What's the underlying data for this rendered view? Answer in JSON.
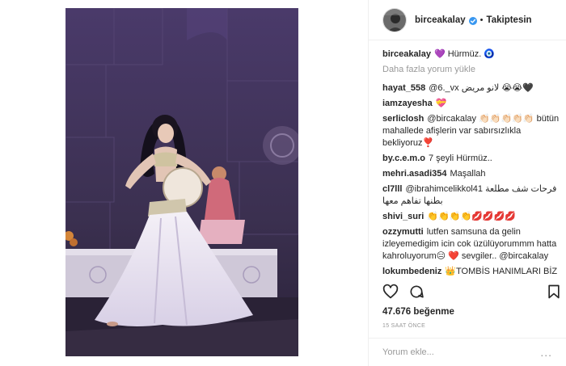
{
  "post": {
    "photo_icon": "dancer-photo",
    "photo_alt": "belly dancer photo"
  },
  "header": {
    "username": "birceakalay",
    "separator": "•",
    "follow_label": "Takiptesin",
    "avatar_icon": "avatar"
  },
  "caption": {
    "username": "birceakalay",
    "text": "💜 Hürmüz. 🧿"
  },
  "load_more": "Daha fazla yorum yükle",
  "comments": [
    {
      "user": "hayat_558",
      "text": "@6._vx لانو مريض 😭😭🖤"
    },
    {
      "user": "iamzayesha",
      "text": "💝"
    },
    {
      "user": "serliclosh",
      "text": "@bircakalay 👏🏻👏🏻👏🏻👏🏻👏🏻 bütün mahallede afişlerin var sabırsızlıkla bekliyoruz❣️"
    },
    {
      "user": "by.c.e.m.o",
      "text": "7 şeyli Hürmüz.."
    },
    {
      "user": "mehri.asadi354",
      "text": "Maşallah"
    },
    {
      "user": "cl7lll",
      "text": "@ibrahimcelikkol41 فرحات شف مطلعة بطنها تفاهم معها"
    },
    {
      "user": "shivi_suri",
      "text": "👏👏👏👏💋💋💋💋"
    },
    {
      "user": "ozzymutti",
      "text": "lutfen samsuna da gelin izleyemedigim icin cok üzülüyorummm hatta kahroluyorum😑 ❤️ sevgiler.. @bircakalay"
    },
    {
      "user": "lokumbedeniz",
      "text": "👑TOMBİS HANIMLARI BİZ"
    }
  ],
  "actions": {
    "like_icon": "heart-icon",
    "comment_icon": "comment-icon",
    "save_icon": "bookmark-icon"
  },
  "likes": "47.676 beğenme",
  "time": "15 SAAT ÖNCE",
  "comment_input": {
    "placeholder": "Yorum ekle...",
    "more": "..."
  },
  "colors": {
    "verified": "#3897f0",
    "text": "#262626",
    "muted": "#999999",
    "border": "#efefef"
  }
}
